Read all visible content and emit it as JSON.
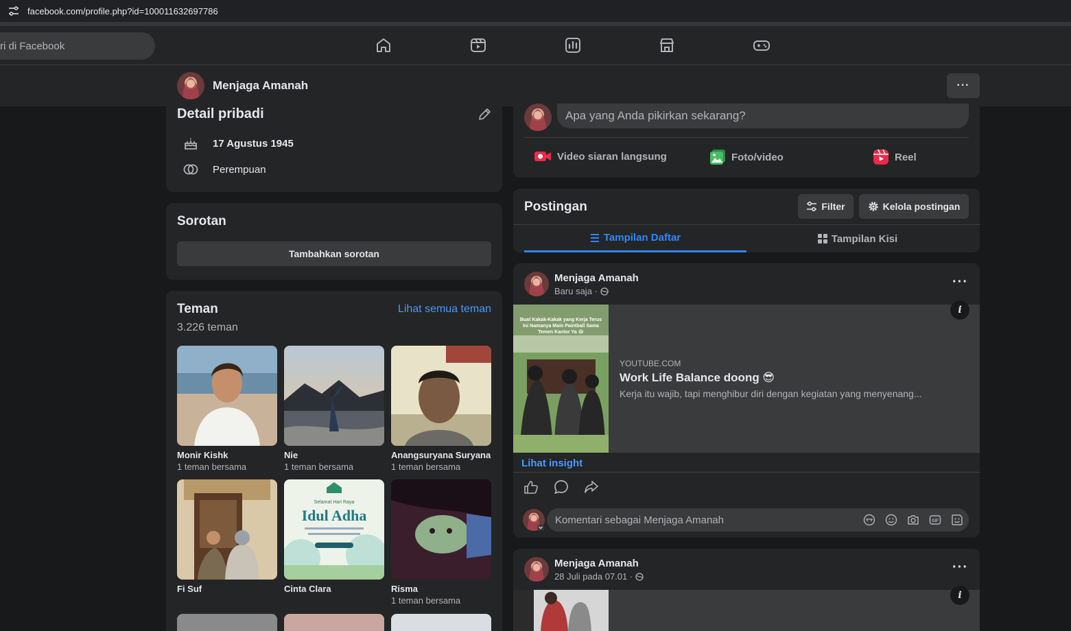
{
  "browser": {
    "url": "facebook.com/profile.php?id=100011632697786"
  },
  "topnav": {
    "search_placeholder": "ri di Facebook",
    "icons": [
      "home-icon",
      "video-icon",
      "dashboard-icon",
      "marketplace-icon",
      "gaming-icon"
    ]
  },
  "profile_bar": {
    "name": "Menjaga Amanah",
    "more": "···"
  },
  "details": {
    "title": "Detail pribadi",
    "birthday": "17 Agustus 1945",
    "gender": "Perempuan"
  },
  "highlights": {
    "title": "Sorotan",
    "add_label": "Tambahkan sorotan"
  },
  "friends": {
    "title": "Teman",
    "see_all": "Lihat semua teman",
    "count": "3.226 teman",
    "items": [
      {
        "name": "Monir Kishk",
        "mutual": "1 teman bersama"
      },
      {
        "name": "Nie",
        "mutual": "1 teman bersama"
      },
      {
        "name": "Anangsuryana Suryana",
        "mutual": "1 teman bersama"
      },
      {
        "name": "Fi Suf",
        "mutual": ""
      },
      {
        "name": "Cinta Clara",
        "mutual": ""
      },
      {
        "name": "Risma",
        "mutual": "1 teman bersama"
      }
    ],
    "idul_adha": {
      "line1": "Selamat Hari Raya",
      "line2": "Idul Adha"
    }
  },
  "composer": {
    "placeholder": "Apa yang Anda pikirkan sekarang?",
    "live_label": "Video siaran langsung",
    "photo_label": "Foto/video",
    "reel_label": "Reel"
  },
  "posts_header": {
    "title": "Postingan",
    "filter_label": "Filter",
    "manage_label": "Kelola postingan",
    "tab_list": "Tampilan Daftar",
    "tab_grid": "Tampilan Kisi"
  },
  "post1": {
    "author": "Menjaga Amanah",
    "time": "Baru saja ·",
    "link_domain": "YOUTUBE.COM",
    "link_title": "Work Life Balance doong 😎",
    "link_desc": "Kerja itu wajib, tapi menghibur diri dengan kegiatan yang menyenang...",
    "thumb_caption": "Buat Kakak-Kakak yang Kerja Terus Ini Namanya Main Paintball Sama Temen Kantor Ya 😂",
    "insight": "Lihat insight",
    "comment_placeholder": "Komentari sebagai Menjaga Amanah"
  },
  "post2": {
    "author": "Menjaga Amanah",
    "time": "28 Juli pada 07.01 ·"
  },
  "colors": {
    "bg": "#18191a",
    "card": "#242526",
    "accent": "#2d88ff",
    "link": "#4599ff"
  }
}
